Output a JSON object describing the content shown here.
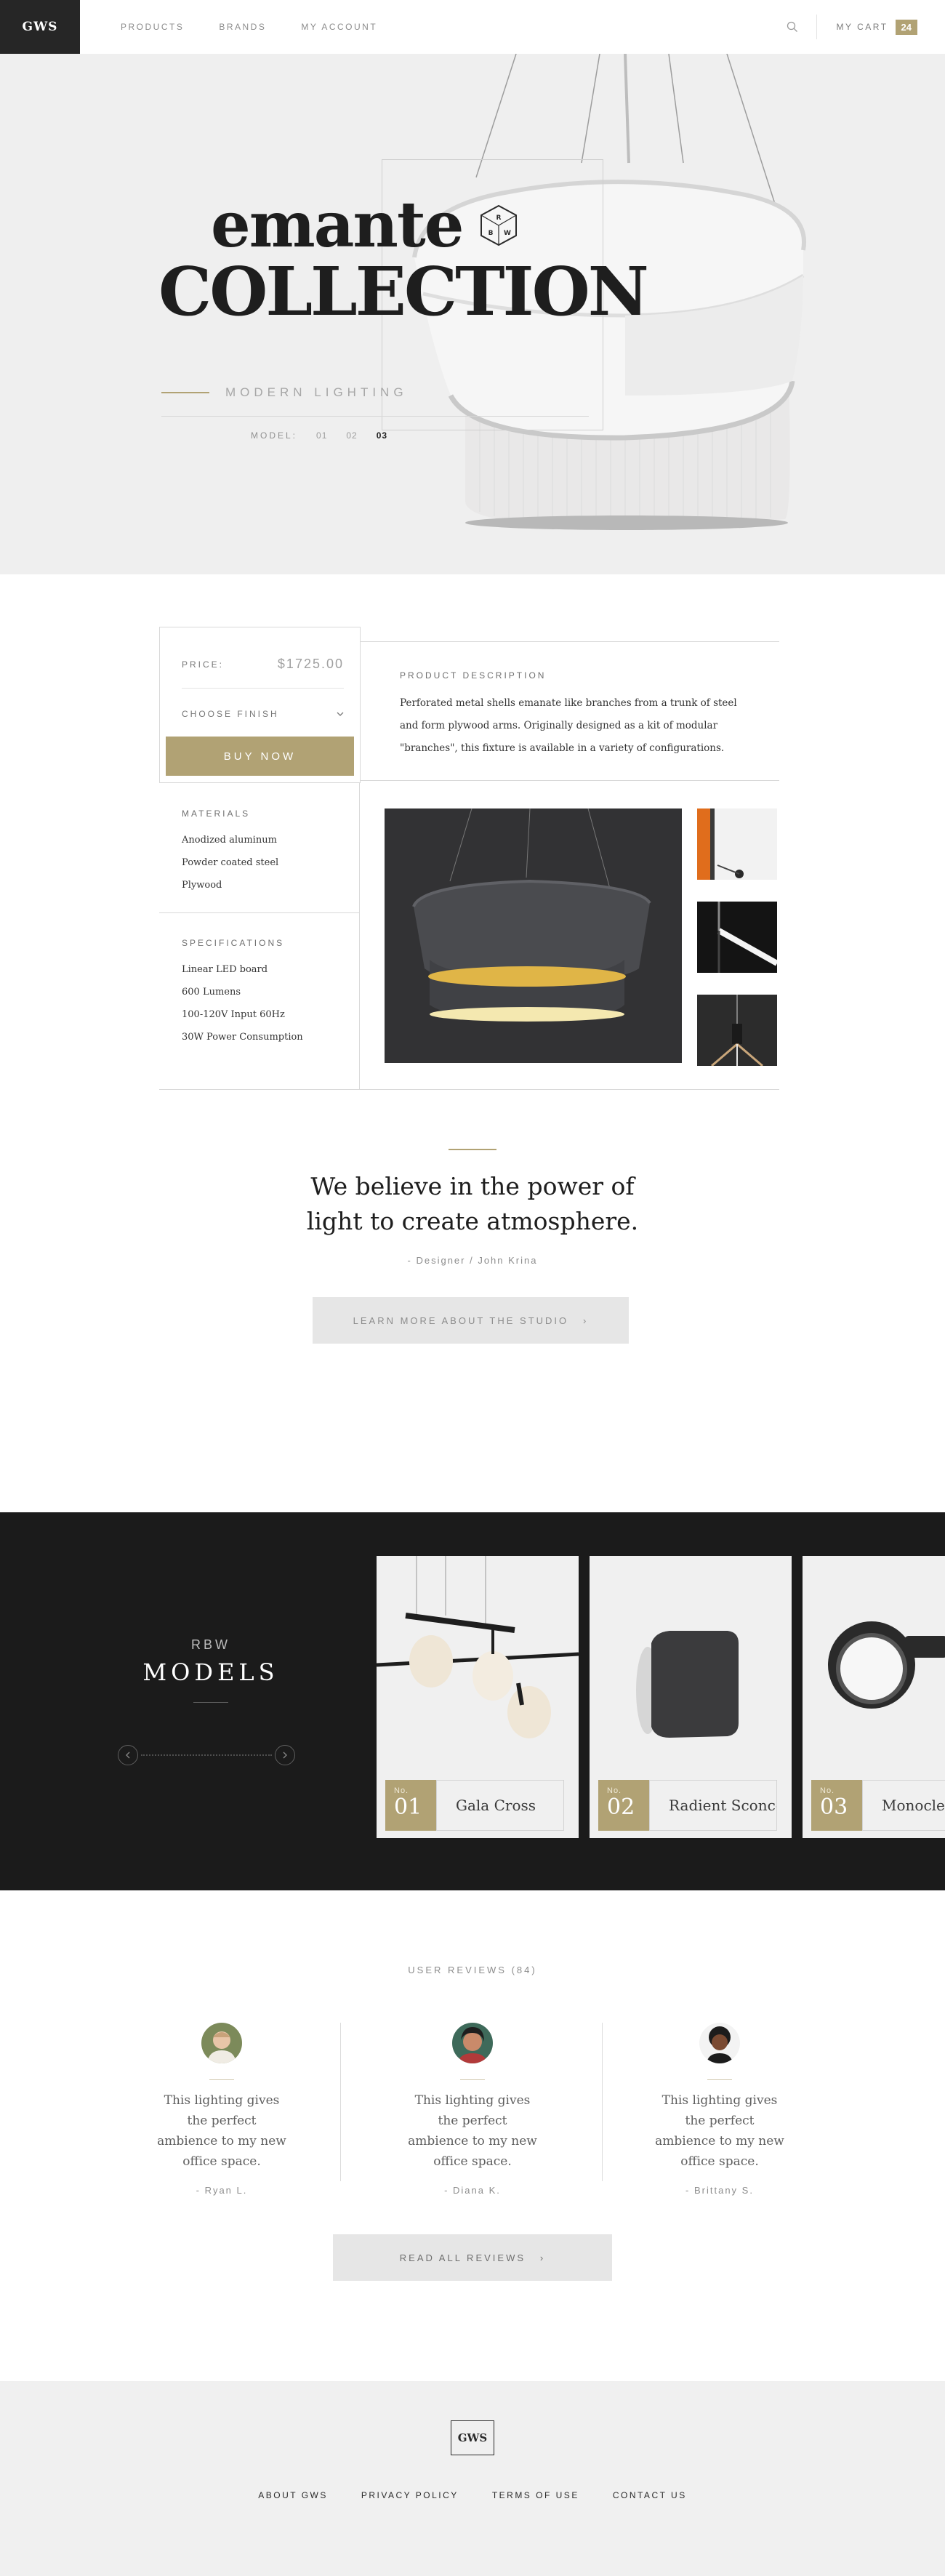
{
  "nav": {
    "logo": "GWS",
    "links": [
      "PRODUCTS",
      "BRANDS",
      "MY ACCOUNT"
    ],
    "cart_label": "MY CART",
    "cart_count": "24"
  },
  "hero": {
    "title_line1": "emante",
    "title_line2": "COLLECTION",
    "badge_letters": [
      "R",
      "B",
      "W"
    ],
    "subtitle": "MODERN LIGHTING",
    "model_label": "MODEL:",
    "models": [
      "01",
      "02",
      "03"
    ],
    "active_model": "03"
  },
  "product": {
    "price_label": "PRICE:",
    "price_value": "$1725.00",
    "finish_label": "CHOOSE FINISH",
    "buy_label": "BUY NOW",
    "description_title": "PRODUCT DESCRIPTION",
    "description_text": "Perforated metal shells emanate like branches from a trunk of steel and form plywood arms. Originally designed as a kit of modular \"branches\", this fixture is available in a variety of configurations.",
    "materials_title": "MATERIALS",
    "materials": [
      "Anodized aluminum",
      "Powder coated steel",
      "Plywood"
    ],
    "specs_title": "SPECIFICATIONS",
    "specs": [
      "Linear LED board",
      "600 Lumens",
      "100-120V Input 60Hz",
      "30W Power Consumption"
    ]
  },
  "quote": {
    "text": "We believe in the power of light to create atmosphere.",
    "author": "- Designer / John Krina",
    "button_label": "LEARN MORE ABOUT THE STUDIO"
  },
  "models": {
    "overline": "RBW",
    "title": "MODELS",
    "cards": [
      {
        "no_label": "No.",
        "number": "01",
        "name": "Gala Cross"
      },
      {
        "no_label": "No.",
        "number": "02",
        "name": "Radient Sconce"
      },
      {
        "no_label": "No.",
        "number": "03",
        "name": "Monocle W"
      }
    ]
  },
  "reviews": {
    "title": "USER REVIEWS (84)",
    "items": [
      {
        "text": "This lighting gives the perfect ambience to my new office space.",
        "author": "- Ryan L."
      },
      {
        "text": "This lighting gives the perfect ambience to my new office space.",
        "author": "- Diana K."
      },
      {
        "text": "This lighting gives the perfect ambience to my new office space.",
        "author": "- Brittany S."
      }
    ],
    "button_label": "READ ALL REVIEWS"
  },
  "footer": {
    "logo": "GWS",
    "links": [
      "ABOUT GWS",
      "PRIVACY POLICY",
      "TERMS OF USE",
      "CONTACT US"
    ]
  },
  "colors": {
    "accent_gold": "#b1a274",
    "dark": "#1b1b1b",
    "hero_bg": "#efefef"
  }
}
